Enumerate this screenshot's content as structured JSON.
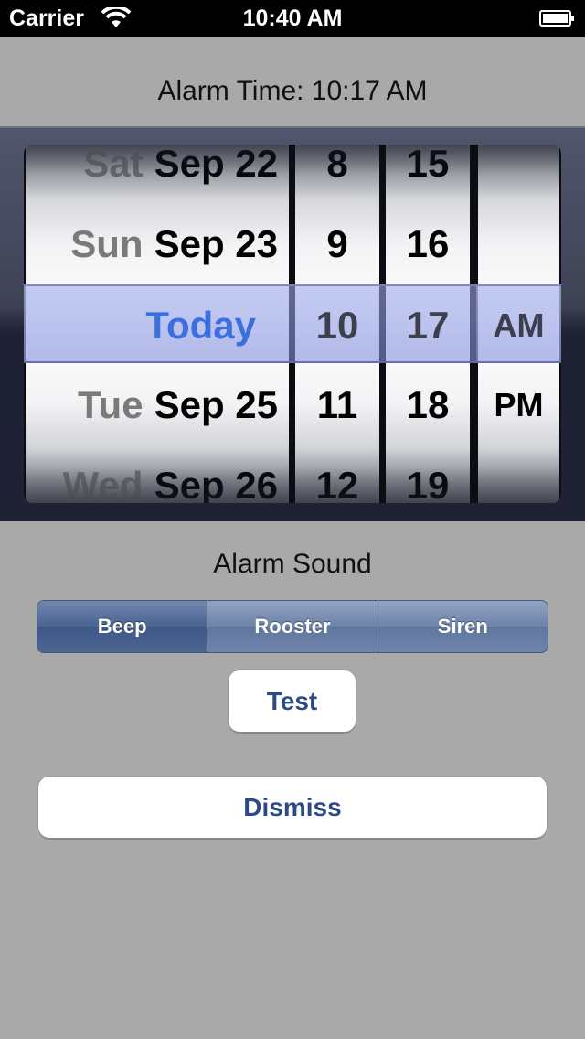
{
  "status_bar": {
    "carrier": "Carrier",
    "time": "10:40 AM"
  },
  "header": {
    "alarm_time": "Alarm Time: 10:17 AM"
  },
  "picker": {
    "date_rows": [
      {
        "day": "Sat",
        "date": "Sep 22"
      },
      {
        "day": "Sun",
        "date": "Sep 23"
      },
      {
        "day": "",
        "date": "Today"
      },
      {
        "day": "Tue",
        "date": "Sep 25"
      },
      {
        "day": "Wed",
        "date": "Sep 26"
      }
    ],
    "hours": [
      "8",
      "9",
      "10",
      "11",
      "12"
    ],
    "minutes": [
      "15",
      "16",
      "17",
      "18",
      "19"
    ],
    "ampm": [
      "",
      "",
      "AM",
      "PM",
      ""
    ],
    "selected": {
      "date": "Today",
      "hour": "10",
      "minute": "17",
      "ampm": "AM"
    }
  },
  "sound": {
    "label": "Alarm Sound",
    "options": [
      "Beep",
      "Rooster",
      "Siren"
    ],
    "selected": "Beep"
  },
  "buttons": {
    "test": "Test",
    "dismiss": "Dismiss"
  },
  "colors": {
    "accent": "#3a6fdd",
    "button_text": "#2e4a86",
    "background": "#a9a9a9"
  }
}
